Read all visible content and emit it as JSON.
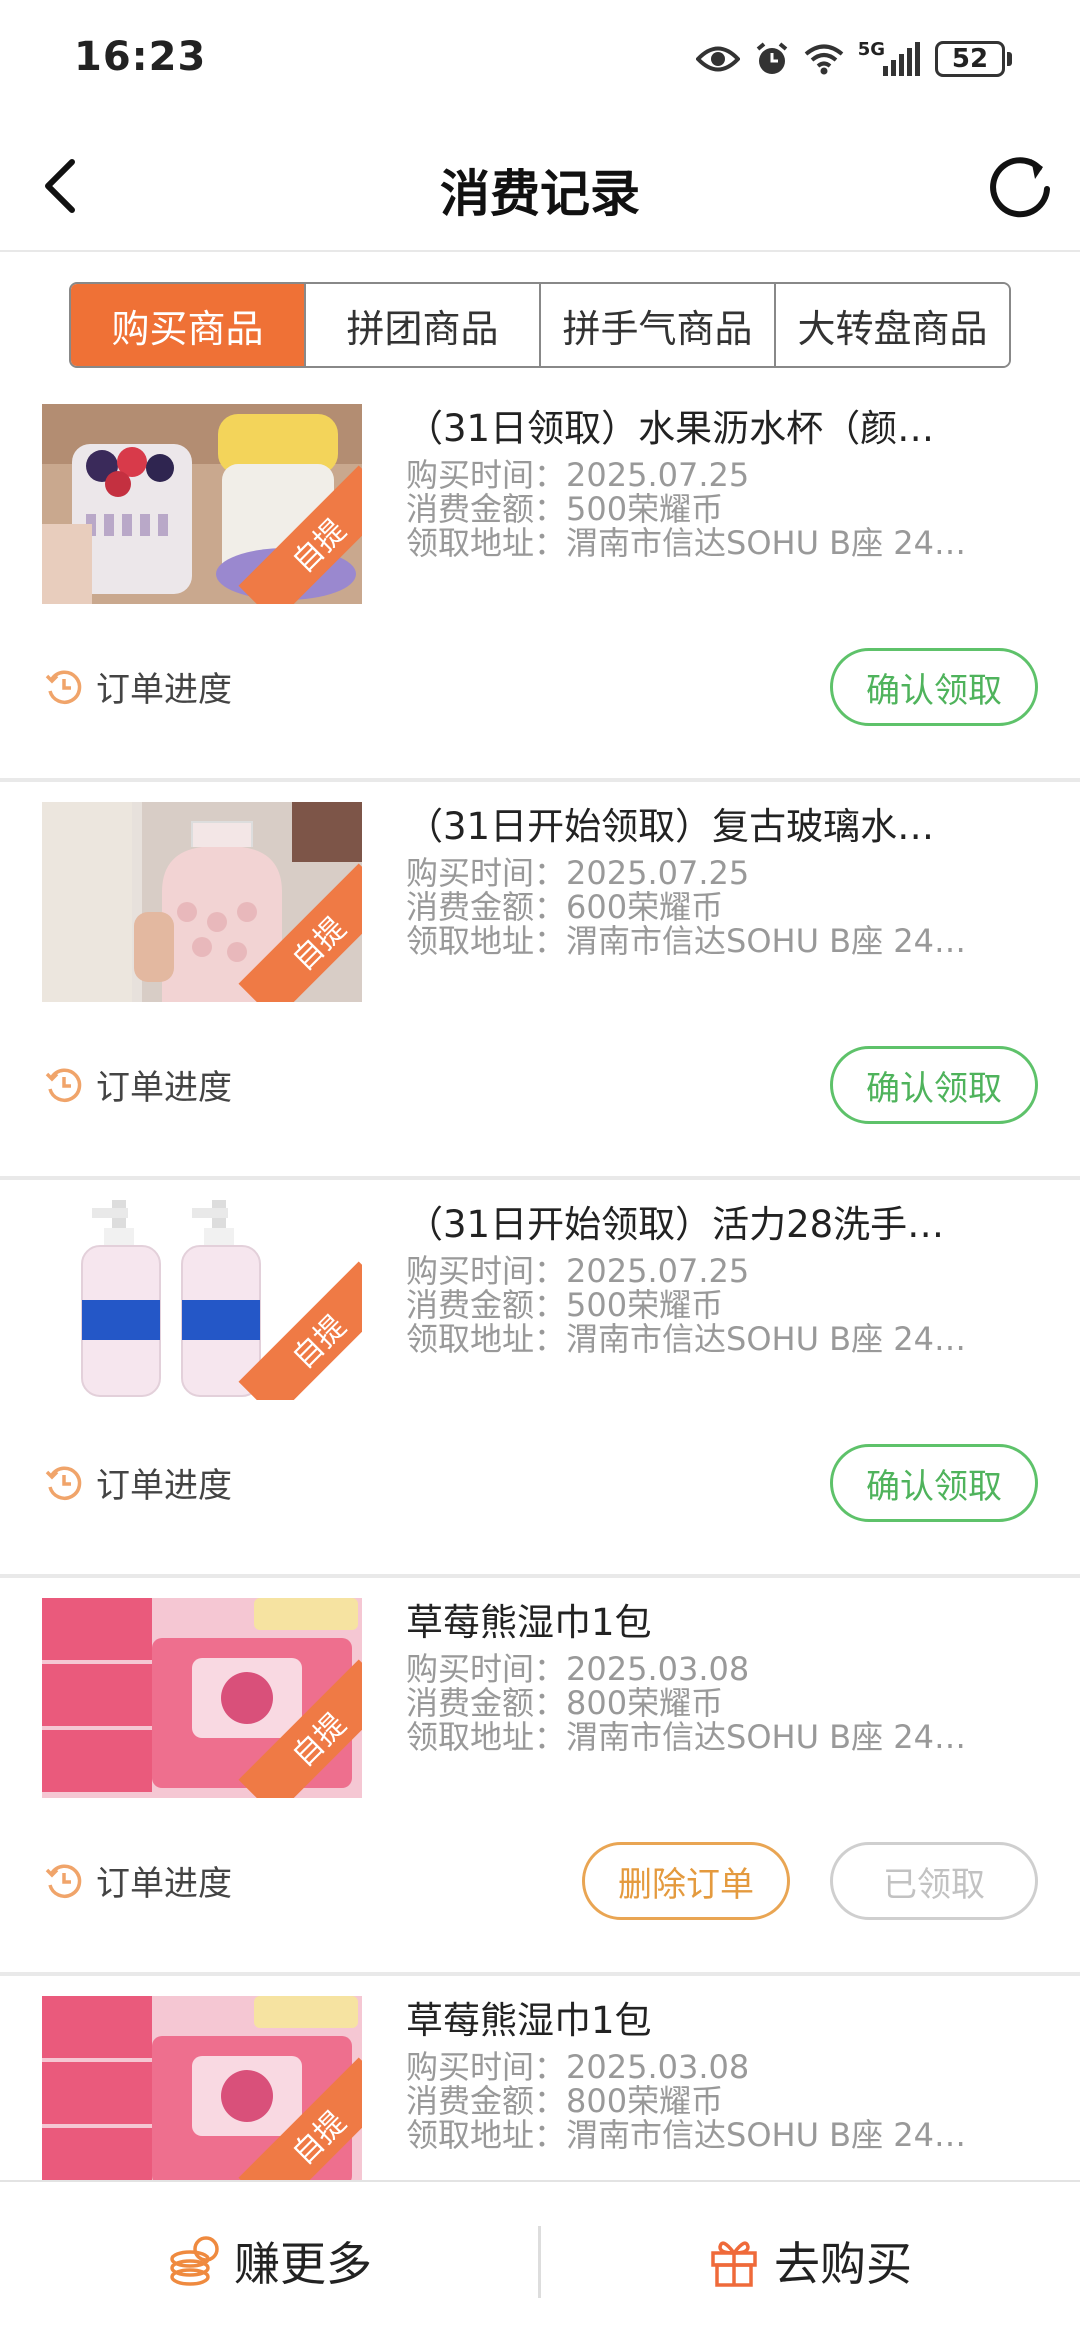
{
  "status_bar": {
    "time": "16:23",
    "network": "5G",
    "battery": "52",
    "icons": [
      "eye-icon",
      "alarm-icon",
      "wifi-icon",
      "signal-icon",
      "battery-icon"
    ]
  },
  "header": {
    "title": "消费记录",
    "back_icon": "chevron-left-icon",
    "refresh_icon": "refresh-icon"
  },
  "tabs": [
    {
      "label": "购买商品",
      "active": true
    },
    {
      "label": "拼团商品",
      "active": false
    },
    {
      "label": "拼手气商品",
      "active": false
    },
    {
      "label": "大转盘商品",
      "active": false
    }
  ],
  "colors": {
    "accent": "#ef7136",
    "confirm_green": "#4fb35c",
    "delete_orange": "#e49a3e",
    "muted": "#c2c2c2"
  },
  "orders": [
    {
      "title": "（31日领取）水果沥水杯（颜…",
      "time": "购买时间：2025.07.25",
      "amount": "消费金额：500荣耀币",
      "address": "领取地址：渭南市信达SOHU B座 24…",
      "badge": "自提",
      "progress_label": "订单进度",
      "action_label": "确认领取"
    },
    {
      "title": "（31日开始领取）复古玻璃水…",
      "time": "购买时间：2025.07.25",
      "amount": "消费金额：600荣耀币",
      "address": "领取地址：渭南市信达SOHU B座 24…",
      "badge": "自提",
      "progress_label": "订单进度",
      "action_label": "确认领取"
    },
    {
      "title": "（31日开始领取）活力28洗手…",
      "time": "购买时间：2025.07.25",
      "amount": "消费金额：500荣耀币",
      "address": "领取地址：渭南市信达SOHU B座 24…",
      "badge": "自提",
      "progress_label": "订单进度",
      "action_label": "确认领取"
    },
    {
      "title": "草莓熊湿巾1包",
      "time": "购买时间：2025.03.08",
      "amount": "消费金额：800荣耀币",
      "address": "领取地址：渭南市信达SOHU B座 24…",
      "badge": "自提",
      "progress_label": "订单进度",
      "delete_label": "删除订单",
      "received_label": "已领取"
    },
    {
      "title": "草莓熊湿巾1包",
      "time": "购买时间：2025.03.08",
      "amount": "消费金额：800荣耀币",
      "address": "领取地址：渭南市信达SOHU B座 24…",
      "badge": "自提"
    }
  ],
  "bottom_bar": {
    "earn_label": "赚更多",
    "earn_icon": "coins-icon",
    "buy_label": "去购买",
    "buy_icon": "gift-icon"
  }
}
